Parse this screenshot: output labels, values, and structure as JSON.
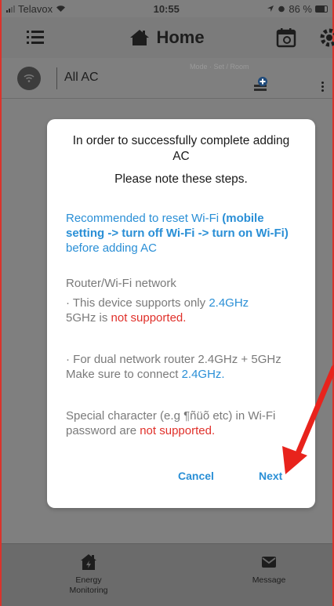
{
  "status_bar": {
    "carrier": "Telavox",
    "time": "10:55",
    "battery": "86 %"
  },
  "nav": {
    "title": "Home",
    "icons": [
      "menu-icon",
      "home-icon",
      "calendar-icon",
      "gear-icon"
    ]
  },
  "ac_row": {
    "name": "All AC",
    "meta": "Mode · Set / Room"
  },
  "dialog": {
    "title": "In order to successfully complete adding AC",
    "subtitle": "Please note these steps.",
    "reset_part1": "Recommended to reset Wi-Fi ",
    "reset_bold": "(mobile setting -> turn off Wi-Fi -> turn on Wi-Fi)",
    "reset_part2": " before adding AC",
    "router_heading": "Router/Wi-Fi network",
    "support_line1_prefix": "· This device supports only ",
    "support_freq": "2.4GHz",
    "support_line2_prefix": "5GHz is ",
    "not_supported": "not supported.",
    "dual_line": "· For dual network router 2.4GHz + 5GHz",
    "connect_prefix": "Make sure to connect ",
    "connect_freq": "2.4GHz.",
    "special_prefix": "Special character (e.g ¶ñüõ etc) in Wi-Fi password are ",
    "special_not_supported": "not supported.",
    "cancel_label": "Cancel",
    "next_label": "Next"
  },
  "tabs": {
    "energy_label_1": "Energy",
    "energy_label_2": "Monitoring",
    "message_label": "Message"
  },
  "colors": {
    "link_blue": "#2a8fd6",
    "warning_red": "#e0302a",
    "arrow_red": "#e8231c"
  }
}
